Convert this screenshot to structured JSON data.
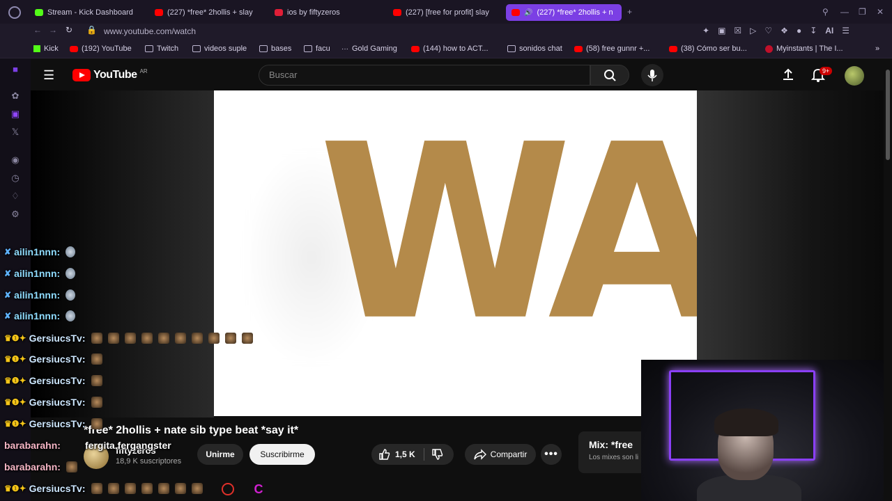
{
  "browser": {
    "tabs": [
      {
        "label": "Stream - Kick Dashboard",
        "favicon": "kick"
      },
      {
        "label": "(227) *free* 2hollis + slay",
        "favicon": "yt"
      },
      {
        "label": "ios by fiftyzeros",
        "favicon": "red"
      },
      {
        "label": "(227) [free for profit] slay",
        "favicon": "yt"
      },
      {
        "label": "(227) *free* 2hollis + n",
        "favicon": "yt",
        "active": true
      }
    ],
    "url": "www.youtube.com/watch",
    "ai_label": "AI",
    "bookmarks": [
      {
        "label": "Kick",
        "icon": "kick"
      },
      {
        "label": "(192) YouTube",
        "icon": "yt"
      },
      {
        "label": "Twitch",
        "icon": "page"
      },
      {
        "label": "videos suple",
        "icon": "folder"
      },
      {
        "label": "bases",
        "icon": "folder"
      },
      {
        "label": "facu",
        "icon": "folder"
      },
      {
        "label": "Gold Gaming",
        "icon": "dots"
      },
      {
        "label": "(144) how to ACT...",
        "icon": "yt"
      },
      {
        "label": "sonidos chat",
        "icon": "folder"
      },
      {
        "label": "(58) free gunnr +...",
        "icon": "yt"
      },
      {
        "label": "(38) Cómo ser bu...",
        "icon": "yt"
      },
      {
        "label": "Myinstants | The I...",
        "icon": "red"
      }
    ],
    "accent_color": "#7b3fe4"
  },
  "youtube": {
    "logo_text": "YouTube",
    "region": "AR",
    "search_placeholder": "Buscar",
    "notifications_badge": "9+",
    "video_overlay_text": "WAC",
    "video_title": "*free* 2hollis + nate sib type beat *say it*",
    "channel_name": "fiftyzeros",
    "subscribers": "18,9 K suscriptores",
    "join_label": "Unirme",
    "subscribe_label": "Suscribirme",
    "like_count": "1,5 K",
    "share_label": "Compartir",
    "mix_title": "Mix: *free",
    "mix_subtitle": "Los mixes son li"
  },
  "chat": {
    "messages": [
      {
        "user": "ailin1nnn:",
        "badge": "sword",
        "emotes": 1,
        "style": "pin"
      },
      {
        "user": "ailin1nnn:",
        "badge": "sword",
        "emotes": 1,
        "style": "pin"
      },
      {
        "user": "ailin1nnn:",
        "badge": "sword",
        "emotes": 1,
        "style": "pin"
      },
      {
        "user": "ailin1nnn:",
        "badge": "sword",
        "emotes": 1,
        "style": "pin"
      },
      {
        "user": "GersiucsTv:",
        "badge": "crown",
        "emotes": 10,
        "style": "face"
      },
      {
        "user": "GersiucsTv:",
        "badge": "crown",
        "emotes": 1,
        "style": "face"
      },
      {
        "user": "GersiucsTv:",
        "badge": "crown",
        "emotes": 1,
        "style": "face"
      },
      {
        "user": "GersiucsTv:",
        "badge": "crown",
        "emotes": 1,
        "style": "face"
      },
      {
        "user": "GersiucsTv:",
        "badge": "crown",
        "emotes": 1,
        "style": "face"
      },
      {
        "user": "barabarahn:",
        "badge": "",
        "emotes": 0,
        "style": "face"
      },
      {
        "user": "fergita.fergangster",
        "badge": "",
        "emotes": 0,
        "style": "face"
      },
      {
        "user": "barabarahn:",
        "badge": "",
        "emotes": 1,
        "style": "face"
      },
      {
        "user": "GersiucsTv:",
        "badge": "crown",
        "emotes": 7,
        "style": "face"
      }
    ]
  }
}
